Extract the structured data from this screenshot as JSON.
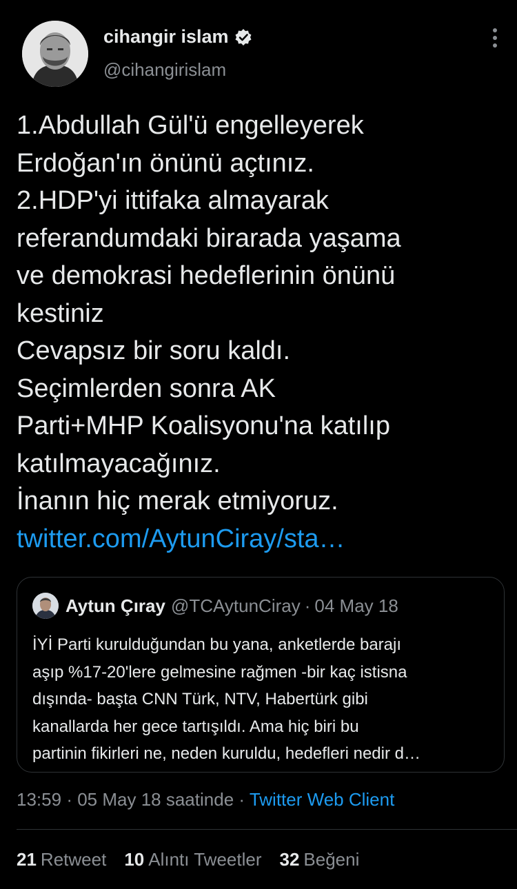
{
  "author": {
    "display_name": "cihangir islam",
    "handle": "@cihangirislam",
    "verified_icon": "verified-badge-icon"
  },
  "tweet": {
    "lines": [
      "1.Abdullah Gül'ü engelleyerek",
      "Erdoğan'ın önünü açtınız.",
      "2.HDP'yi ittifaka almayarak",
      "referandumdaki birarada yaşama",
      "ve demokrasi hedeflerinin önünü",
      "kestiniz",
      "Cevapsız bir soru kaldı.",
      "Seçimlerden sonra AK",
      "Parti+MHP Koalisyonu'na katılıp",
      "katılmayacağınız.",
      "İnanın hiç merak etmiyoruz."
    ],
    "link": "twitter.com/AytunCiray/sta…"
  },
  "quote": {
    "name": "Aytun Çıray",
    "handle": "@TCAytunCiray",
    "separator": "·",
    "date": "04 May 18",
    "lines": [
      "İYİ Parti kurulduğundan bu yana, anketlerde barajı",
      "aşıp %17-20'lere gelmesine rağmen -bir kaç istisna",
      "dışında- başta CNN Türk, NTV, Habertürk gibi",
      "kanallarda her gece tartışıldı. Ama hiç biri bu",
      "partinin fikirleri ne, neden kuruldu, hedefleri nedir d…"
    ]
  },
  "meta": {
    "time": "13:59",
    "separator1": "·",
    "date": "05 May 18 saatinde",
    "separator2": "·",
    "source": "Twitter Web Client"
  },
  "stats": {
    "retweets_count": "21",
    "retweets_label": "Retweet",
    "quotes_count": "10",
    "quotes_label": "Alıntı Tweetler",
    "likes_count": "32",
    "likes_label": "Beğeni"
  },
  "colors": {
    "background": "#000000",
    "text": "#e7e9ea",
    "secondary": "#8b8f94",
    "link": "#1d9bf0",
    "border": "#2f3336"
  }
}
